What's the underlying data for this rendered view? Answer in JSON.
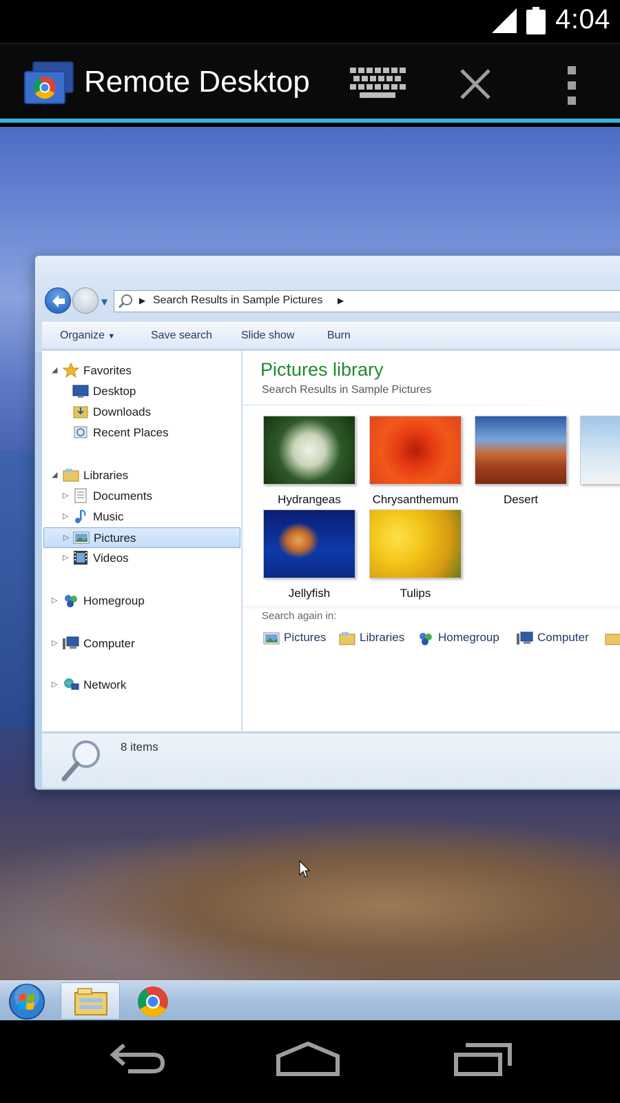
{
  "status_bar": {
    "time": "4:04",
    "signal_icon": "cell-signal-icon",
    "battery_icon": "battery-icon"
  },
  "action_bar": {
    "title": "Remote Desktop",
    "app_icon": "chrome-remote-desktop-icon",
    "keyboard_icon": "keyboard-icon",
    "close_icon": "close-icon",
    "overflow_icon": "overflow-menu-icon",
    "accent_color": "#33b5e5"
  },
  "explorer": {
    "address": {
      "breadcrumb": "Search Results in Sample Pictures"
    },
    "commands": [
      "Organize",
      "Save search",
      "Slide show",
      "Burn"
    ],
    "nav_pane": {
      "favorites": "Favorites",
      "desktop": "Desktop",
      "downloads": "Downloads",
      "recent_places": "Recent Places",
      "libraries": "Libraries",
      "documents": "Documents",
      "music": "Music",
      "pictures": "Pictures",
      "videos": "Videos",
      "homegroup": "Homegroup",
      "computer": "Computer",
      "network": "Network",
      "selected": "Pictures"
    },
    "content": {
      "title": "Pictures library",
      "subtitle": "Search Results in Sample Pictures",
      "thumbnails": [
        "Hydrangeas",
        "Chrysanthemum",
        "Desert",
        "P",
        "Jellyfish",
        "Tulips"
      ],
      "search_again_label": "Search again in:",
      "search_again_items": [
        "Pictures",
        "Libraries",
        "Homegroup",
        "Computer"
      ]
    },
    "details": {
      "count": "8 items"
    }
  },
  "taskbar": {
    "start_icon": "windows-start-icon",
    "items": [
      "windows-explorer-icon",
      "chrome-icon"
    ]
  },
  "nav_bar": {
    "back_icon": "back-icon",
    "home_icon": "home-icon",
    "recents_icon": "recent-apps-icon"
  }
}
